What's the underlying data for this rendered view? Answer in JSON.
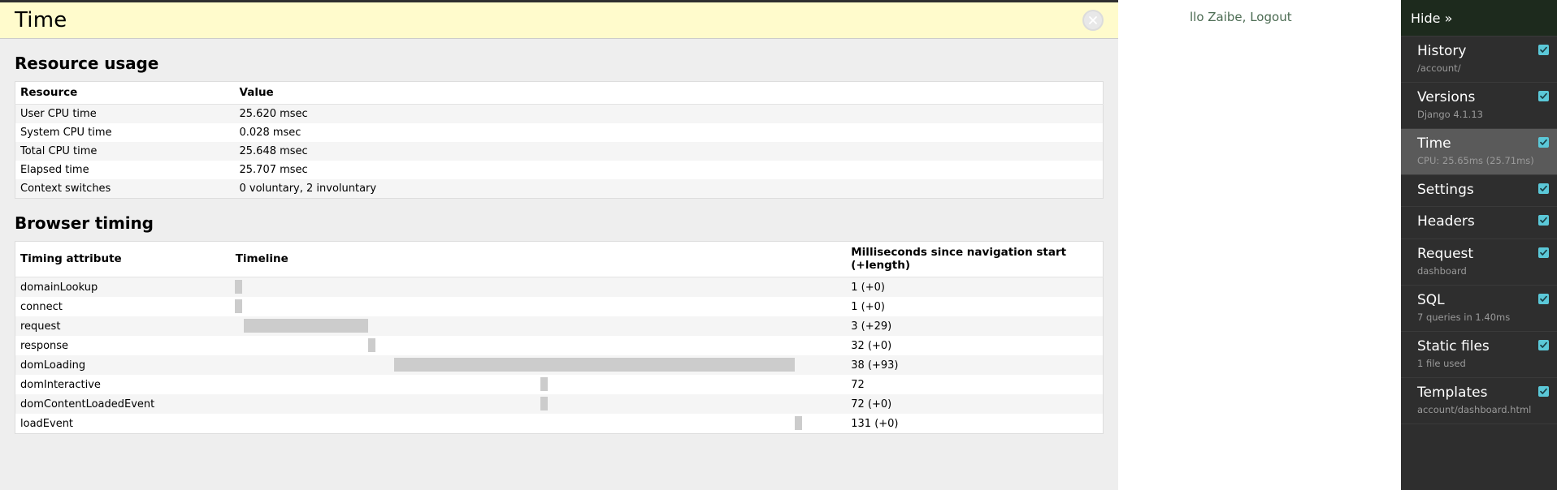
{
  "behind_page": {
    "greeting_prefix": "llo Zaibe,",
    "logout_label": "Logout"
  },
  "panel": {
    "title": "Time",
    "close_icon": "close-circle-icon",
    "resource_usage": {
      "heading": "Resource usage",
      "columns": [
        "Resource",
        "Value"
      ],
      "rows": [
        [
          "User CPU time",
          "25.620 msec"
        ],
        [
          "System CPU time",
          "0.028 msec"
        ],
        [
          "Total CPU time",
          "25.648 msec"
        ],
        [
          "Elapsed time",
          "25.707 msec"
        ],
        [
          "Context switches",
          "0 voluntary, 2 involuntary"
        ]
      ]
    },
    "browser_timing": {
      "heading": "Browser timing",
      "columns": [
        "Timing attribute",
        "Timeline",
        "Milliseconds since navigation start (+length)"
      ],
      "rows": [
        {
          "attribute": "domainLookup",
          "start": 1,
          "length": 0,
          "ms": "1 (+0)"
        },
        {
          "attribute": "connect",
          "start": 1,
          "length": 0,
          "ms": "1 (+0)"
        },
        {
          "attribute": "request",
          "start": 3,
          "length": 29,
          "ms": "3 (+29)"
        },
        {
          "attribute": "response",
          "start": 32,
          "length": 0,
          "ms": "32 (+0)"
        },
        {
          "attribute": "domLoading",
          "start": 38,
          "length": 93,
          "ms": "38 (+93)"
        },
        {
          "attribute": "domInteractive",
          "start": 72,
          "length": 0,
          "ms": "72"
        },
        {
          "attribute": "domContentLoadedEvent",
          "start": 72,
          "length": 0,
          "ms": "72 (+0)"
        },
        {
          "attribute": "loadEvent",
          "start": 131,
          "length": 0,
          "ms": "131 (+0)"
        }
      ],
      "scale_max_ms": 143
    }
  },
  "toolbar": {
    "hide_label": "Hide »",
    "accent_color": "#5bc8d8",
    "items": [
      {
        "label": "History",
        "sub": "/account/",
        "checked": true,
        "active": false
      },
      {
        "label": "Versions",
        "sub": "Django 4.1.13",
        "checked": true,
        "active": false
      },
      {
        "label": "Time",
        "sub": "CPU: 25.65ms (25.71ms)",
        "checked": true,
        "active": true
      },
      {
        "label": "Settings",
        "sub": "",
        "checked": true,
        "active": false
      },
      {
        "label": "Headers",
        "sub": "",
        "checked": true,
        "active": false
      },
      {
        "label": "Request",
        "sub": "dashboard",
        "checked": true,
        "active": false
      },
      {
        "label": "SQL",
        "sub": "7 queries in 1.40ms",
        "checked": true,
        "active": false
      },
      {
        "label": "Static files",
        "sub": "1 file used",
        "checked": true,
        "active": false
      },
      {
        "label": "Templates",
        "sub": "account/dashboard.html",
        "checked": true,
        "active": false
      }
    ]
  }
}
